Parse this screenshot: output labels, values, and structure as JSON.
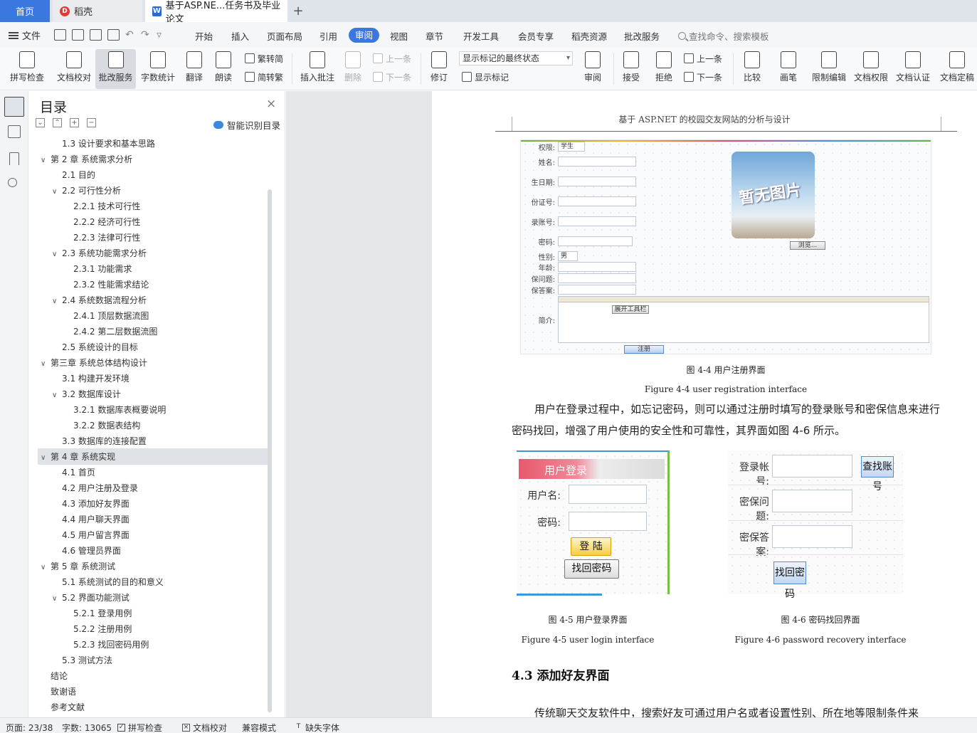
{
  "tabs": {
    "home": "首页",
    "daoke": "稻壳",
    "doc": "基于ASP.NE...任务书及毕业论文",
    "plus": "+"
  },
  "menu": {
    "file": "文件",
    "items": [
      "开始",
      "插入",
      "页面布局",
      "引用",
      "审阅",
      "视图",
      "章节",
      "开发工具",
      "会员专享",
      "稻壳资源",
      "批改服务"
    ],
    "active": "审阅",
    "search": "查找命令、搜索模板"
  },
  "ribbon": {
    "spell": "拼写检查",
    "proofread": "文档校对",
    "correction": "批改服务",
    "wordcount": "字数统计",
    "translate": "翻译",
    "read": "朗读",
    "trad": "繁转简",
    "simp": "简转繁",
    "insert_comment": "插入批注",
    "delete": "删除",
    "prev": "上一条",
    "next": "下一条",
    "track": "修订",
    "markup_state": "显示标记的最终状态",
    "show_markup": "显示标记",
    "review": "审阅",
    "accept": "接受",
    "reject": "拒绝",
    "prev2": "上一条",
    "next2": "下一条",
    "compare": "比较",
    "pen": "画笔",
    "restrict": "限制编辑",
    "perm": "文档权限",
    "cert": "文档认证",
    "finalize": "文档定稿"
  },
  "toc": {
    "title": "目录",
    "smart": "智能识别目录",
    "items": [
      {
        "label": "1.3 设计要求和基本思路",
        "level": 2,
        "arrow": ""
      },
      {
        "label": "第 2 章  系统需求分析",
        "level": 1,
        "arrow": "v"
      },
      {
        "label": "2.1 目的",
        "level": 2,
        "arrow": ""
      },
      {
        "label": "2.2 可行性分析",
        "level": 2,
        "arrow": "v"
      },
      {
        "label": "2.2.1 技术可行性",
        "level": 3,
        "arrow": ""
      },
      {
        "label": "2.2.2 经济可行性",
        "level": 3,
        "arrow": ""
      },
      {
        "label": "2.2.3 法律可行性",
        "level": 3,
        "arrow": ""
      },
      {
        "label": "2.3 系统功能需求分析",
        "level": 2,
        "arrow": "v"
      },
      {
        "label": "2.3.1 功能需求",
        "level": 3,
        "arrow": ""
      },
      {
        "label": "2.3.2 性能需求结论",
        "level": 3,
        "arrow": ""
      },
      {
        "label": "2.4 系统数据流程分析",
        "level": 2,
        "arrow": "v"
      },
      {
        "label": "2.4.1 顶层数据流图",
        "level": 3,
        "arrow": ""
      },
      {
        "label": "2.4.2 第二层数据流图",
        "level": 3,
        "arrow": ""
      },
      {
        "label": "2.5 系统设计的目标",
        "level": 2,
        "arrow": ""
      },
      {
        "label": "第三章  系统总体结构设计",
        "level": 1,
        "arrow": "v"
      },
      {
        "label": "3.1 构建开发环境",
        "level": 2,
        "arrow": ""
      },
      {
        "label": "3.2 数据库设计",
        "level": 2,
        "arrow": "v"
      },
      {
        "label": "3.2.1 数据库表概要说明",
        "level": 3,
        "arrow": ""
      },
      {
        "label": "3.2.2 数据表结构",
        "level": 3,
        "arrow": ""
      },
      {
        "label": "3.3 数据库的连接配置",
        "level": 2,
        "arrow": ""
      },
      {
        "label": "第 4 章  系统实现",
        "level": 1,
        "arrow": "v"
      },
      {
        "label": "4.1 首页",
        "level": 2,
        "arrow": ""
      },
      {
        "label": "4.2 用户注册及登录",
        "level": 2,
        "arrow": ""
      },
      {
        "label": "4.3 添加好友界面",
        "level": 2,
        "arrow": ""
      },
      {
        "label": "4.4 用户聊天界面",
        "level": 2,
        "arrow": ""
      },
      {
        "label": "4.5 用户留言界面",
        "level": 2,
        "arrow": ""
      },
      {
        "label": "4.6 管理员界面",
        "level": 2,
        "arrow": ""
      },
      {
        "label": "第 5 章  系统测试",
        "level": 1,
        "arrow": "v"
      },
      {
        "label": "5.1 系统测试的目的和意义",
        "level": 2,
        "arrow": ""
      },
      {
        "label": "5.2 界面功能测试",
        "level": 2,
        "arrow": "v"
      },
      {
        "label": "5.2.1 登录用例",
        "level": 3,
        "arrow": ""
      },
      {
        "label": "5.2.2 注册用例",
        "level": 3,
        "arrow": ""
      },
      {
        "label": "5.2.3 找回密码用例",
        "level": 3,
        "arrow": ""
      },
      {
        "label": "5.3 测试方法",
        "level": 2,
        "arrow": ""
      },
      {
        "label": "结论",
        "level": 1,
        "arrow": ""
      },
      {
        "label": "致谢语",
        "level": 1,
        "arrow": ""
      },
      {
        "label": "参考文献",
        "level": 1,
        "arrow": ""
      }
    ],
    "selected_index": 20
  },
  "page": {
    "header": "基于 ASP.NET 的校园交友网站的分析与设计",
    "fig44": {
      "labels": [
        "权限:",
        "姓名:",
        "生日期:",
        "份证号:",
        "录账号:",
        "密码:",
        "性别:",
        "年龄:",
        "保问题:",
        "保答案:",
        "简介:"
      ],
      "role": "学生",
      "gender": "男",
      "photo_text": "暂无图片",
      "browse": "浏览...",
      "toolbar": "展开工具栏",
      "submit": "注册"
    },
    "cap44_cn": "图 4-4 用户注册界面",
    "cap44_en": "Figure 4-4 user registration interface",
    "para1": "用户在登录过程中，如忘记密码，则可以通过注册时填写的登录账号和密保信息来进行密码找回，增强了用户使用的安全性和可靠性，其界面如图 4-6 所示。",
    "fig45": {
      "header": "用户登录",
      "user": "用户名:",
      "pwd": "密码:",
      "login": "登 陆",
      "find": "找回密码"
    },
    "fig46": {
      "account": "登录帐号:",
      "question": "密保问题:",
      "answer": "密保答案:",
      "search": "查找账号",
      "find": "找回密码"
    },
    "cap45_cn": "图 4-5 用户登录界面",
    "cap45_en": "Figure 4-5 user login interface",
    "cap46_cn": "图 4-6 密码找回界面",
    "cap46_en": "Figure 4-6 password recovery interface",
    "h43": "4.3 添加好友界面",
    "para2": "传统聊天交友软件中，搜索好友可通过用户名或者设置性别、所在地等限制条件来"
  },
  "status": {
    "page": "页面: 23/38",
    "words": "字数: 13065",
    "spell": "拼写检查",
    "proof": "文档校对",
    "compat": "兼容模式",
    "font": "缺失字体"
  }
}
